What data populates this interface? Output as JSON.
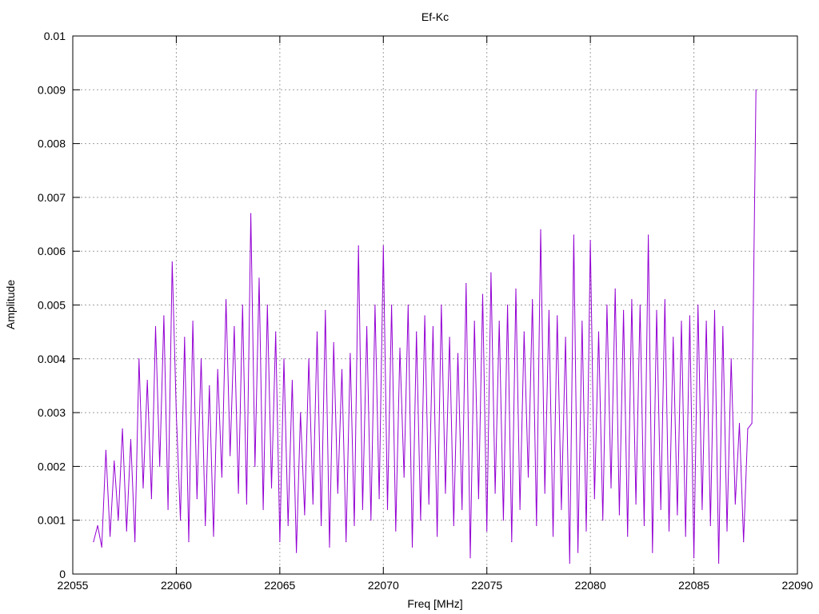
{
  "chart_data": {
    "type": "line",
    "title": "Ef-Kc",
    "xlabel": "Freq [MHz]",
    "ylabel": "Amplitude",
    "xlim": [
      22055,
      22090
    ],
    "ylim": [
      0,
      0.01
    ],
    "xticks": [
      "22055",
      "22060",
      "22065",
      "22070",
      "22075",
      "22080",
      "22085",
      "22090"
    ],
    "xtick_values": [
      22055,
      22060,
      22065,
      22070,
      22075,
      22080,
      22085,
      22090
    ],
    "yticks": [
      "0",
      "0.001",
      "0.002",
      "0.003",
      "0.004",
      "0.005",
      "0.006",
      "0.007",
      "0.008",
      "0.009",
      "0.01"
    ],
    "ytick_values": [
      0,
      0.001,
      0.002,
      0.003,
      0.004,
      0.005,
      0.006,
      0.007,
      0.008,
      0.009,
      0.01
    ],
    "grid": true,
    "legend": "none",
    "series": [
      {
        "name": "Ef-Kc",
        "color": "#9400d3",
        "x_start": 22056.0,
        "x_step": 0.2,
        "values": [
          0.0006,
          0.0009,
          0.0005,
          0.0023,
          0.0007,
          0.0021,
          0.001,
          0.0027,
          0.0008,
          0.0025,
          0.0006,
          0.004,
          0.0016,
          0.0036,
          0.0014,
          0.0046,
          0.002,
          0.0048,
          0.0012,
          0.0058,
          0.003,
          0.001,
          0.0044,
          0.0006,
          0.0047,
          0.0014,
          0.004,
          0.0009,
          0.0035,
          0.0007,
          0.0038,
          0.0018,
          0.0051,
          0.0022,
          0.0046,
          0.0015,
          0.005,
          0.0013,
          0.0067,
          0.002,
          0.0055,
          0.0012,
          0.005,
          0.0016,
          0.0045,
          0.0006,
          0.004,
          0.0009,
          0.0036,
          0.0004,
          0.003,
          0.0011,
          0.004,
          0.0013,
          0.0045,
          0.0009,
          0.0049,
          0.0005,
          0.0043,
          0.0015,
          0.0038,
          0.0006,
          0.0041,
          0.0009,
          0.0061,
          0.0012,
          0.0046,
          0.001,
          0.005,
          0.0014,
          0.0061,
          0.0012,
          0.005,
          0.0008,
          0.0042,
          0.0018,
          0.005,
          0.0005,
          0.0045,
          0.001,
          0.0048,
          0.0013,
          0.0046,
          0.0007,
          0.005,
          0.0015,
          0.0044,
          0.0009,
          0.0041,
          0.0012,
          0.0054,
          0.0003,
          0.0047,
          0.0014,
          0.0052,
          0.0008,
          0.0056,
          0.0015,
          0.0047,
          0.001,
          0.005,
          0.0006,
          0.0053,
          0.0012,
          0.0045,
          0.0018,
          0.0051,
          0.0009,
          0.0064,
          0.0015,
          0.0049,
          0.0007,
          0.0048,
          0.0012,
          0.0044,
          0.0002,
          0.0063,
          0.0004,
          0.0047,
          0.0008,
          0.0062,
          0.0014,
          0.0045,
          0.001,
          0.005,
          0.0016,
          0.0053,
          0.0011,
          0.0049,
          0.0007,
          0.0051,
          0.0013,
          0.005,
          0.0009,
          0.0063,
          0.0004,
          0.0049,
          0.0012,
          0.0051,
          0.0008,
          0.0044,
          0.0011,
          0.0047,
          0.0007,
          0.0048,
          0.0003,
          0.005,
          0.0012,
          0.0047,
          0.0009,
          0.0049,
          0.0002,
          0.0046,
          0.0008,
          0.004,
          0.0013,
          0.0028,
          0.0006,
          0.0027,
          0.0028,
          0.009
        ]
      }
    ]
  }
}
